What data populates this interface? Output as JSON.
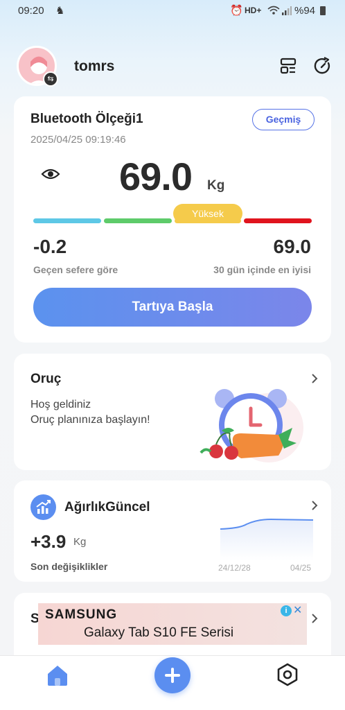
{
  "status_bar": {
    "time": "09:20",
    "network": "HD+",
    "battery": "%94"
  },
  "header": {
    "username": "tomrs"
  },
  "scale_card": {
    "device": "Bluetooth Ölçeği1",
    "history_button": "Geçmiş",
    "datetime": "2025/04/25 09:19:46",
    "weight": "69.0",
    "unit": "Kg",
    "level_badge": "Yüksek",
    "level_colors": [
      "#5ec8e6",
      "#5ecb6a",
      "#f5cb4b",
      "#e0141e"
    ],
    "change_value": "-0.2",
    "change_label": "Geçen sefere göre",
    "best_value": "69.0",
    "best_label": "30 gün içinde en iyisi",
    "start_button": "Tartıya Başla"
  },
  "fasting_card": {
    "title": "Oruç",
    "line1": "Hoş geldiniz",
    "line2": "Oruç planınıza başlayın!"
  },
  "weight_update_card": {
    "title": "AğırlıkGüncel",
    "change_value": "+3.9",
    "change_unit": "Kg",
    "subtitle": "Son değişiklikler",
    "chart_start_label": "24/12/28",
    "chart_end_label": "04/25"
  },
  "partial_card": {
    "title_initial": "S"
  },
  "ad_banner": {
    "brand": "SAMSUNG",
    "product": "Galaxy Tab S10 FE Serisi"
  },
  "bottom_nav": [
    "home",
    "add",
    "settings"
  ]
}
